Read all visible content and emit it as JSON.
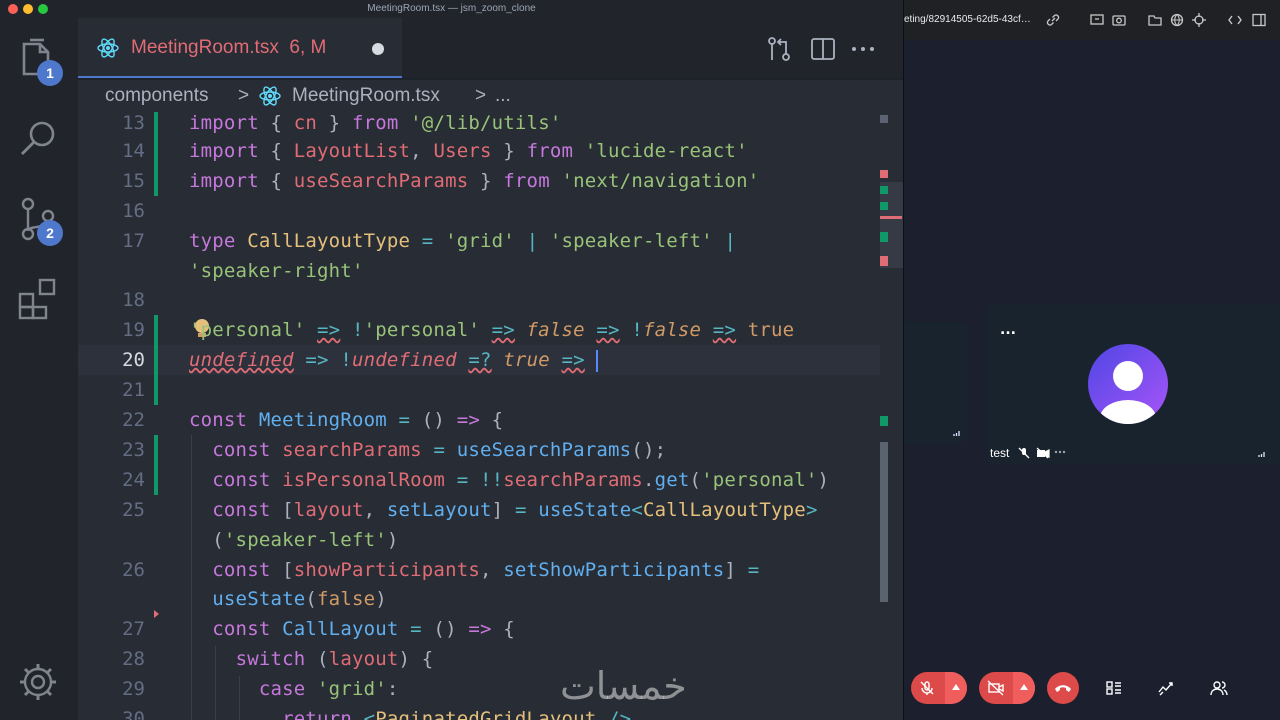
{
  "window": {
    "title": "MeetingRoom.tsx — jsm_zoom_clone"
  },
  "activity_bar": {
    "explorer_badge": "1",
    "source_control_badge": "2"
  },
  "tab": {
    "filename": "MeetingRoom.tsx",
    "status": "6, M"
  },
  "breadcrumb": {
    "folder": "components",
    "separator": ">",
    "file": "MeetingRoom.tsx",
    "more": "..."
  },
  "editor": {
    "active_line": "20",
    "lines": [
      {
        "num": "13",
        "text": "import { cn } from '@/lib/utils'"
      },
      {
        "num": "14",
        "text": "import { LayoutList, Users } from 'lucide-react'"
      },
      {
        "num": "15",
        "text": "import { useSearchParams } from 'next/navigation'"
      },
      {
        "num": "16",
        "text": ""
      },
      {
        "num": "17",
        "text": "type CallLayoutType = 'grid' | 'speaker-left' | 'speaker-right'"
      },
      {
        "num": "18",
        "text": ""
      },
      {
        "num": "19",
        "text": "'personal' => !'personal' => false => !false => true"
      },
      {
        "num": "20",
        "text": "undefined => !undefined =? true =>"
      },
      {
        "num": "21",
        "text": ""
      },
      {
        "num": "22",
        "text": "const MeetingRoom = () => {"
      },
      {
        "num": "23",
        "text": "const searchParams = useSearchParams();"
      },
      {
        "num": "24",
        "text": "const isPersonalRoom = !!searchParams.get('personal')"
      },
      {
        "num": "25",
        "text": "const [layout, setLayout] = useState<CallLayoutType>('speaker-left')"
      },
      {
        "num": "26",
        "text": "const [showParticipants, setShowParticipants] = useState(false)"
      },
      {
        "num": "27",
        "text": "const CallLayout = () => {"
      },
      {
        "num": "28",
        "text": "switch (layout) {"
      },
      {
        "num": "29",
        "text": "case 'grid':"
      },
      {
        "num": "30",
        "text": "return <PaginatedGridLayout />"
      }
    ]
  },
  "browser": {
    "url": "eting/82914505-62d5-43cf…"
  },
  "meeting": {
    "participant_name": "test",
    "more_label": "..."
  },
  "watermark": "خمسات",
  "colors": {
    "editor_bg": "#282c34",
    "sidebar_bg": "#21252b",
    "accent": "#4d78cc",
    "meeting_bg": "#1c1f2e",
    "danger": "#dc4a4a"
  }
}
